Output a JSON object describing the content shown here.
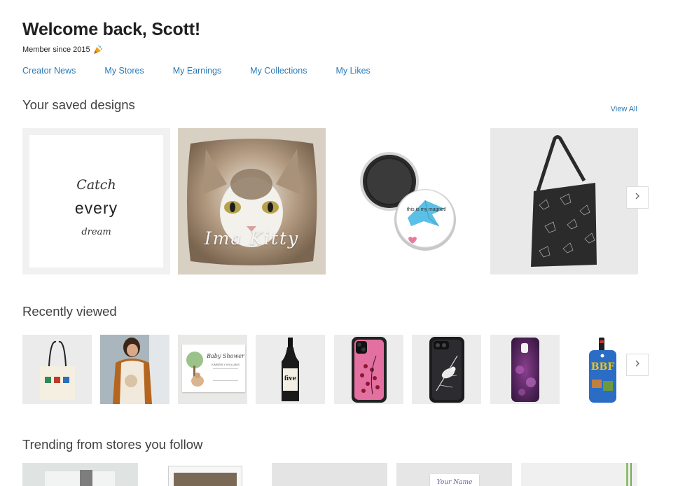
{
  "header": {
    "welcome": "Welcome back, Scott!",
    "member_since": "Member since 2015",
    "party_icon": "party-popper-icon"
  },
  "nav": [
    "Creator News",
    "My Stores",
    "My Earnings",
    "My Collections",
    "My Likes"
  ],
  "saved": {
    "title": "Your saved designs",
    "view_all": "View All",
    "items": [
      {
        "kind": "poster",
        "lines": [
          "Catch",
          "every",
          "dream"
        ]
      },
      {
        "kind": "pillow",
        "caption": "Ima Kitty"
      },
      {
        "kind": "magnet",
        "caption": "this is my magnet!"
      },
      {
        "kind": "bag"
      }
    ]
  },
  "recent": {
    "title": "Recently viewed",
    "items": [
      {
        "kind": "tote"
      },
      {
        "kind": "maternity-shirt"
      },
      {
        "kind": "invitation",
        "caption": "Baby Shower",
        "sub": "KIMBERLY WILLIAMS"
      },
      {
        "kind": "wine",
        "label": "five"
      },
      {
        "kind": "pink-phone-case"
      },
      {
        "kind": "bird-phone-case"
      },
      {
        "kind": "purple-phone-case"
      },
      {
        "kind": "luggage-tag",
        "label": "BBF"
      }
    ]
  },
  "trending": {
    "title": "Trending from stores you follow",
    "card_caption": "Your Name"
  },
  "colors": {
    "link": "#2a7ab8",
    "text": "#212121",
    "tile_bg": "#f1f1f1"
  }
}
